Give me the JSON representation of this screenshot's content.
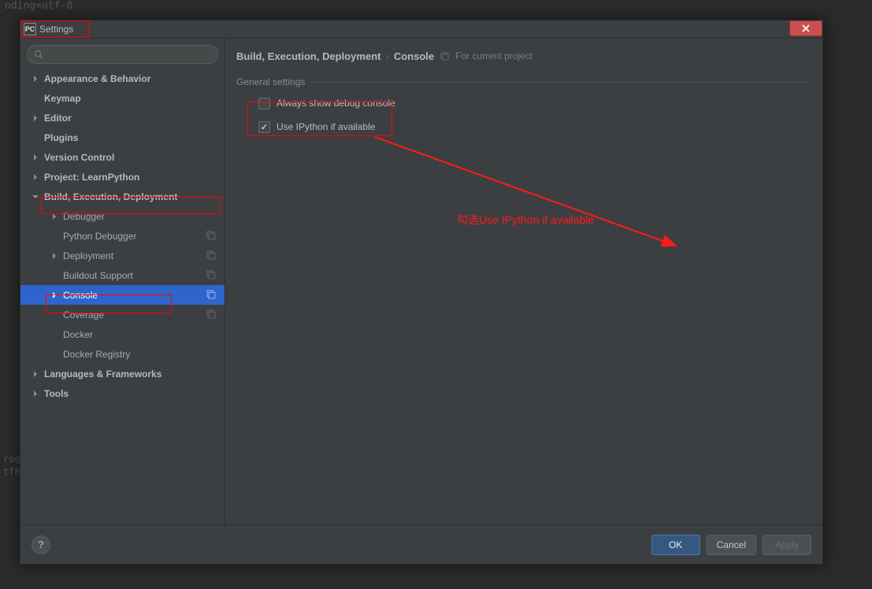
{
  "background": {
    "top_text": "oding=utf-8",
    "lower_line1": "rog",
    "lower_line2": "tf8"
  },
  "titlebar": {
    "app_icon": "PC",
    "title": "Settings"
  },
  "search": {
    "placeholder": ""
  },
  "tree": {
    "items": [
      {
        "label": "Appearance & Behavior",
        "arrow": "right",
        "bold": true
      },
      {
        "label": "Keymap",
        "bold": true
      },
      {
        "label": "Editor",
        "arrow": "right",
        "bold": true
      },
      {
        "label": "Plugins",
        "bold": true
      },
      {
        "label": "Version Control",
        "arrow": "right",
        "bold": true
      },
      {
        "label": "Project: LearnPython",
        "arrow": "right",
        "bold": true
      },
      {
        "label": "Build, Execution, Deployment",
        "arrow": "down",
        "bold": true
      },
      {
        "label": "Debugger",
        "arrow": "right",
        "depth": 1
      },
      {
        "label": "Python Debugger",
        "depth": 1,
        "copy": true
      },
      {
        "label": "Deployment",
        "arrow": "right",
        "depth": 1,
        "copy": true
      },
      {
        "label": "Buildout Support",
        "depth": 1,
        "copy": true
      },
      {
        "label": "Console",
        "arrow": "right",
        "depth": 1,
        "copy": true,
        "selected": true
      },
      {
        "label": "Coverage",
        "depth": 1,
        "copy": true
      },
      {
        "label": "Docker",
        "depth": 1
      },
      {
        "label": "Docker Registry",
        "depth": 1
      },
      {
        "label": "Languages & Frameworks",
        "arrow": "right",
        "bold": true
      },
      {
        "label": "Tools",
        "arrow": "right",
        "bold": true
      }
    ]
  },
  "breadcrumb": {
    "part1": "Build, Execution, Deployment",
    "sep": "›",
    "part2": "Console",
    "project_scope": "For current project"
  },
  "general": {
    "header": "General settings",
    "opt1": "Always show debug console",
    "opt2": "Use IPython if available"
  },
  "annotation": {
    "text": "勾选Use IPython if available"
  },
  "footer": {
    "help": "?",
    "ok": "OK",
    "cancel": "Cancel",
    "apply": "Apply"
  }
}
